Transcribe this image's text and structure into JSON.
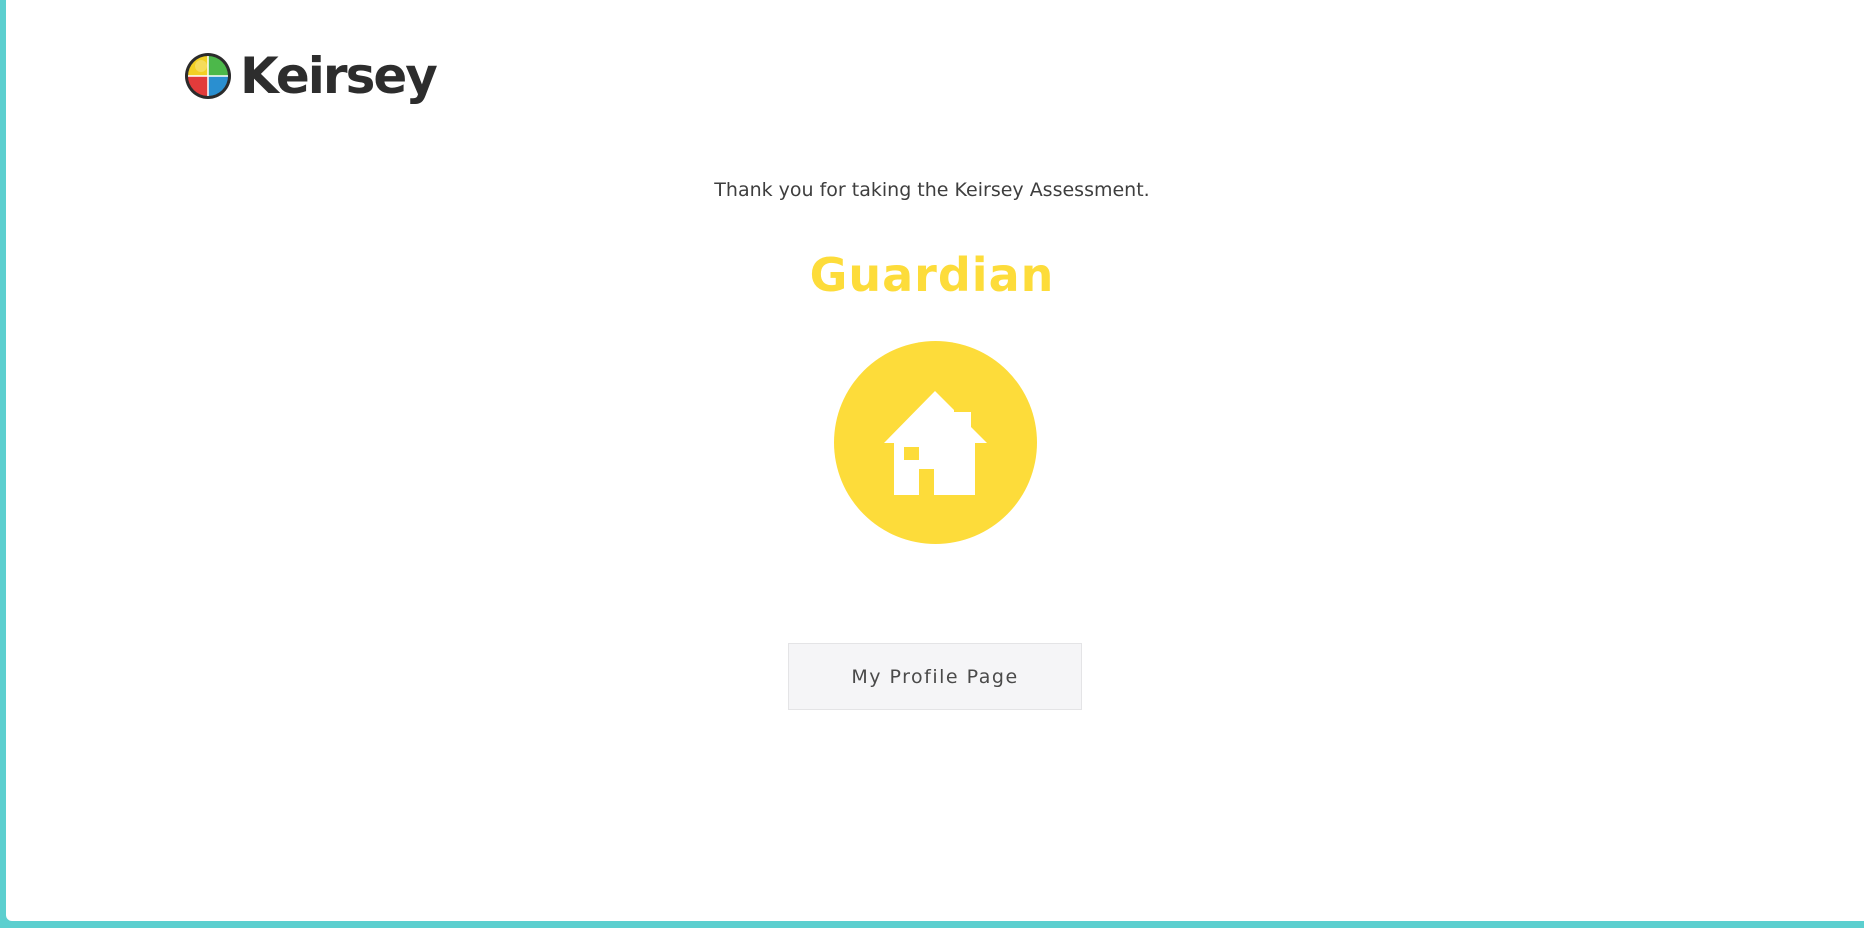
{
  "brand": {
    "name": "Keirsey",
    "logo_icon": "color-wheel-logo-icon"
  },
  "result": {
    "message": "Thank you for taking the Keirsey Assessment.",
    "temperament": "Guardian",
    "badge_icon": "house-icon",
    "accent_color": "#fddc3a"
  },
  "actions": {
    "profile_button_label": "My Profile Page"
  },
  "colors": {
    "frame": "#5ccfcf",
    "text": "#3e3e3e",
    "logo_text": "#2d2d2d"
  }
}
